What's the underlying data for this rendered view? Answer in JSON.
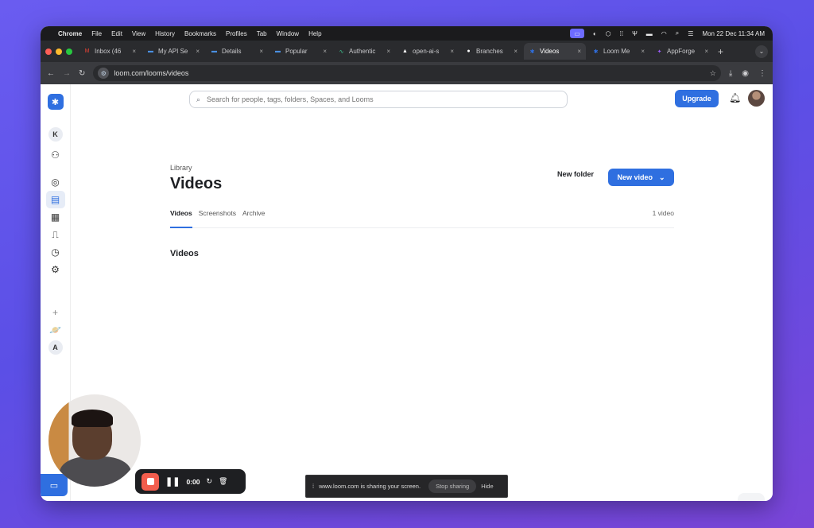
{
  "menubar": {
    "apple": "",
    "app": "Chrome",
    "items": [
      "File",
      "Edit",
      "View",
      "History",
      "Bookmarks",
      "Profiles",
      "Tab",
      "Window",
      "Help"
    ],
    "datetime": "Mon 22 Dec  11:34 AM"
  },
  "browser": {
    "tabs": [
      {
        "label": "Inbox (46",
        "icon": "gmail-icon",
        "color": "#ea4335",
        "glyph": "M"
      },
      {
        "label": "My API Se",
        "icon": "loom-dash-icon",
        "color": "#4a90e2",
        "glyph": "▬"
      },
      {
        "label": "Details",
        "icon": "loom-dash-icon",
        "color": "#4a90e2",
        "glyph": "▬"
      },
      {
        "label": "Popular",
        "icon": "loom-dash-icon",
        "color": "#4a90e2",
        "glyph": "▬"
      },
      {
        "label": "Authentic",
        "icon": "pulse-icon",
        "color": "#3ec28f",
        "glyph": "∿"
      },
      {
        "label": "open-ai-s",
        "icon": "triangle-icon",
        "color": "#ffffff",
        "glyph": "▲"
      },
      {
        "label": "Branches",
        "icon": "github-icon",
        "color": "#ffffff",
        "glyph": "●"
      },
      {
        "label": "Videos",
        "icon": "loom-icon",
        "color": "#2f6fe0",
        "glyph": "✱",
        "active": true
      },
      {
        "label": "Loom Me",
        "icon": "loom-icon",
        "color": "#2f6fe0",
        "glyph": "✱"
      },
      {
        "label": "AppForge",
        "icon": "appforge-icon",
        "color": "#9b5cf6",
        "glyph": "✦"
      }
    ],
    "url": "loom.com/looms/videos"
  },
  "header": {
    "search_placeholder": "Search for people, tags, folders, Spaces, and Looms",
    "upgrade_label": "Upgrade"
  },
  "sidebar": {
    "workspace_initial": "K",
    "bottom_initial": "A"
  },
  "main": {
    "breadcrumb": "Library",
    "title": "Videos",
    "new_folder_label": "New folder",
    "new_video_label": "New video",
    "tabs": [
      "Videos",
      "Screenshots",
      "Archive"
    ],
    "video_count": "1 video",
    "section_title": "Videos"
  },
  "recorder": {
    "timer": "0:00"
  },
  "sharebar": {
    "message": "www.loom.com is sharing your screen.",
    "stop_label": "Stop sharing",
    "hide_label": "Hide"
  },
  "help_label": "?",
  "colors": {
    "accent": "#2f6fe0",
    "stop_red": "#f25d4d",
    "background": "#5b4fe6"
  }
}
